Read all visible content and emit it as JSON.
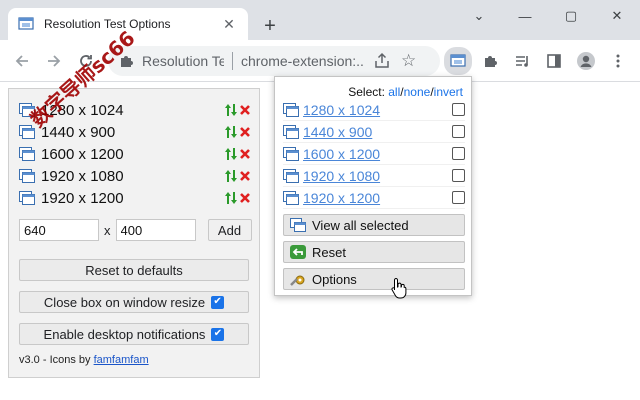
{
  "tab": {
    "title": "Resolution Test Options",
    "close_icon": "close-icon",
    "favicon": "resolution-favicon-icon"
  },
  "window": {
    "minimize": "—",
    "maximize": "▢",
    "close": "✕",
    "dropdown": "⌄",
    "newtab": "+"
  },
  "omnibox": {
    "site": "Resolution Te",
    "url": "chrome-extension:..."
  },
  "options": {
    "resolutions": [
      {
        "label": "1280 x 1024"
      },
      {
        "label": "1440 x 900"
      },
      {
        "label": "1600 x 1200"
      },
      {
        "label": "1920 x 1080"
      },
      {
        "label": "1920 x 1200"
      }
    ],
    "watermark": "数字导师sc66",
    "width_value": "640",
    "height_value": "400",
    "x_label": "x",
    "add_label": "Add",
    "reset_label": "Reset to defaults",
    "close_box_label": "Close box on window resize",
    "close_box_checked": true,
    "notifications_label": "Enable desktop notifications",
    "notifications_checked": true,
    "footer_prefix": "v3.0 - Icons by ",
    "footer_link": "famfamfam"
  },
  "popup": {
    "select_label": "Select:",
    "select_all": "all",
    "select_none": "none",
    "select_invert": "invert",
    "slash": "/",
    "items": [
      {
        "label": "1280 x 1024",
        "checked": false
      },
      {
        "label": "1440 x 900",
        "checked": false
      },
      {
        "label": "1600 x 1200",
        "checked": false
      },
      {
        "label": "1920 x 1080",
        "checked": false
      },
      {
        "label": "1920 x 1200",
        "checked": false
      }
    ],
    "view_all_label": "View all selected",
    "reset_label": "Reset",
    "options_label": "Options"
  },
  "colors": {
    "link": "#1a73e8",
    "popup_link": "#4a86d8",
    "checkbox": "#1a73e8",
    "delete": "#e02020",
    "move": "#2a9a2a"
  }
}
